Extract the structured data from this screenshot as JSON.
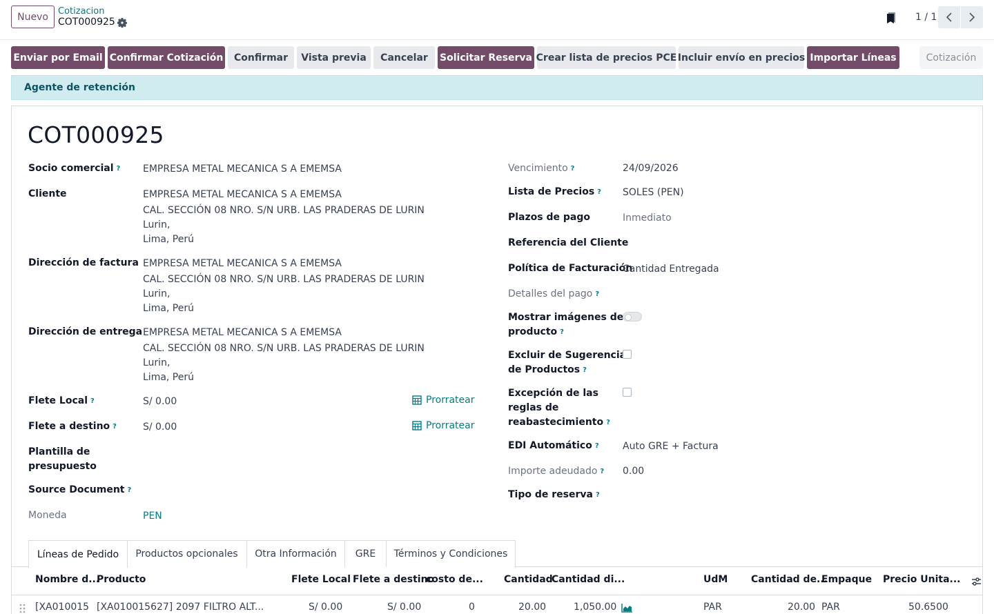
{
  "control": {
    "new_label": "Nuevo",
    "breadcrumb_parent": "Cotizacion",
    "breadcrumb_current": "COT000925",
    "pager": "1 / 1"
  },
  "actions": [
    {
      "label": "Enviar por Email",
      "style": "primary"
    },
    {
      "label": "Confirmar Cotización",
      "style": "primary"
    },
    {
      "label": "Confirmar",
      "style": "secondary"
    },
    {
      "label": "Vista previa",
      "style": "secondary"
    },
    {
      "label": "Cancelar",
      "style": "secondary"
    },
    {
      "label": "Solicitar Reserva",
      "style": "primary"
    },
    {
      "label": "Crear lista de precios PCE",
      "style": "secondary"
    },
    {
      "label": "Incluir envío en precios",
      "style": "secondary"
    },
    {
      "label": "Importar Líneas",
      "style": "primary"
    }
  ],
  "status": "Cotización",
  "alert": "Agente de retención",
  "form": {
    "title": "COT000925",
    "left": {
      "socio_label": "Socio comercial",
      "socio_value": "EMPRESA METAL MECANICA S A EMEMSA",
      "cliente_label": "Cliente",
      "cliente_lines": [
        "EMPRESA METAL MECANICA S A EMEMSA",
        "CAL. SECCIÓN 08 NRO. S/N URB. LAS PRADERAS DE LURIN",
        "Lurin,",
        "Lima, Perú"
      ],
      "factura_label": "Dirección de factura",
      "factura_lines": [
        "EMPRESA METAL MECANICA S A EMEMSA",
        "CAL. SECCIÓN 08 NRO. S/N URB. LAS PRADERAS DE LURIN",
        "Lurin,",
        "Lima, Perú"
      ],
      "entrega_label": "Dirección de entrega",
      "entrega_lines": [
        "EMPRESA METAL MECANICA S A EMEMSA",
        "CAL. SECCIÓN 08 NRO. S/N URB. LAS PRADERAS DE LURIN",
        "Lurin,",
        "Lima, Perú"
      ],
      "flete_local_label": "Flete Local",
      "flete_local_value": "S/ 0.00",
      "flete_destino_label": "Flete a destino",
      "flete_destino_value": "S/ 0.00",
      "prorratear": "Prorratear",
      "plantilla_label_1": "Plantilla de",
      "plantilla_label_2": "presupuesto",
      "source_label": "Source Document",
      "moneda_label": "Moneda",
      "moneda_value": "PEN"
    },
    "right": {
      "vencimiento_label": "Vencimiento",
      "vencimiento_value": "24/09/2026",
      "lista_label": "Lista de Precios",
      "lista_value": "SOLES (PEN)",
      "plazos_label": "Plazos de pago",
      "plazos_value": "Inmediato",
      "referencia_label": "Referencia del Cliente",
      "politica_label": "Política de Facturación",
      "politica_value": "Cantidad Entregada",
      "detalles_label": "Detalles del pago",
      "mostrar_label_1": "Mostrar imágenes de",
      "mostrar_label_2": "producto",
      "excluir_label_1": "Excluir de Sugerencias",
      "excluir_label_2": "de Productos",
      "excepcion_label_1": "Excepción de las",
      "excepcion_label_2": "reglas de",
      "excepcion_label_3": "reabastecimiento",
      "edi_label": "EDI Automático",
      "edi_value": "Auto GRE + Factura",
      "importe_label": "Importe adeudado",
      "importe_value": "0.00",
      "tipo_reserva_label": "Tipo de reserva"
    }
  },
  "tabs": [
    "Líneas de Pedido",
    "Productos opcionales",
    "Otra Información",
    "GRE",
    "Términos y Condiciones"
  ],
  "table": {
    "headers": [
      "Nombre d...",
      "Producto",
      "Flete Local",
      "Flete a destino",
      "costo de...",
      "Cantidad",
      "Cantidad di...",
      "UdM",
      "Cantidad de...",
      "Empaque",
      "Precio Unita..."
    ],
    "row": [
      "[XA010015",
      "[XA010015627] 2097 FILTRO ALT...",
      "S/ 0.00",
      "S/ 0.00",
      "0",
      "20.00",
      "1,050.00",
      "PAR",
      "20.00",
      "PAR",
      "50.6500"
    ]
  }
}
